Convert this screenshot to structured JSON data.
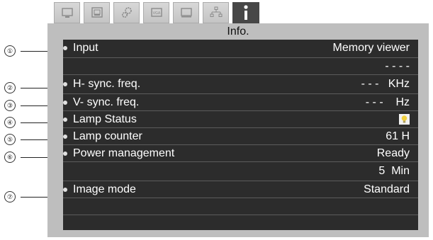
{
  "tabs": [
    {
      "icon": "monitor-icon",
      "active": false
    },
    {
      "icon": "picture-adjust-icon",
      "active": false
    },
    {
      "icon": "settings-gear-icon",
      "active": false
    },
    {
      "icon": "video-screen-icon",
      "active": false
    },
    {
      "icon": "display-icon",
      "active": false
    },
    {
      "icon": "network-icon",
      "active": false
    },
    {
      "icon": "info-icon",
      "active": true
    }
  ],
  "panel": {
    "title": "Info."
  },
  "rows": [
    {
      "num": "①",
      "label": "Input",
      "value": "Memory viewer"
    },
    {
      "num": "",
      "label": "",
      "value": "- - - -"
    },
    {
      "num": "②",
      "label": "H- sync. freq.",
      "value": "- - -   KHz"
    },
    {
      "num": "③",
      "label": "V- sync. freq.",
      "value": "- - -    Hz"
    },
    {
      "num": "④",
      "label": "Lamp Status",
      "value": "",
      "icon": "lamp-bulb-icon"
    },
    {
      "num": "⑤",
      "label": "Lamp counter",
      "value": "61 H"
    },
    {
      "num": "⑥",
      "label": "Power management",
      "value": "Ready"
    },
    {
      "num": "",
      "label": "",
      "value": "5  Min"
    },
    {
      "num": "⑦",
      "label": "Image mode",
      "value": "Standard"
    },
    {
      "num": "",
      "label": "",
      "value": ""
    }
  ],
  "colors": {
    "panel_bg": "#bebebe",
    "screen_bg": "#2c2c2c",
    "row_divider": "#5c5c5c",
    "lamp_bulb": "#f0d040"
  }
}
